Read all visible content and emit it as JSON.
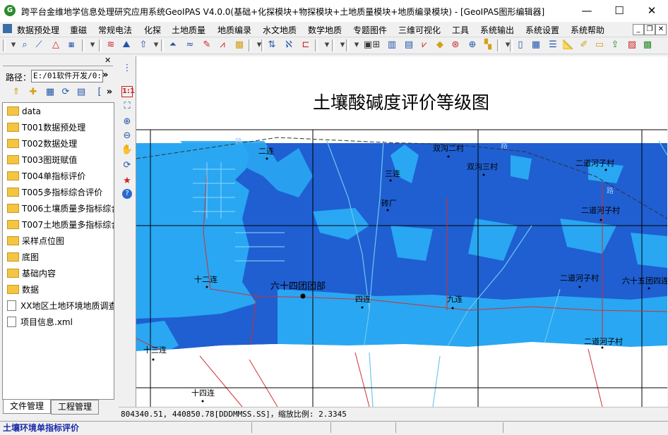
{
  "window": {
    "title": "跨平台金维地学信息处理研究应用系统GeoIPAS V4.0.0(基础+化探模块+物探模块+土地质量模块+地质编录模块) - [GeoIPAS图形编辑器]",
    "app_icon": "G",
    "minimize": "—",
    "maximize": "☐",
    "close": "✕"
  },
  "menu": {
    "items": [
      "数据预处理",
      "重磁",
      "常规电法",
      "化探",
      "土地质量",
      "地质编录",
      "水文地质",
      "数学地质",
      "专题图件",
      "三维可视化",
      "工具",
      "系统输出",
      "系统设置",
      "系统帮助"
    ],
    "mdi_min": "_",
    "mdi_restore": "❐",
    "mdi_close": "✕"
  },
  "left_panel": {
    "close_glyph": "✕",
    "path_label": "路径：",
    "path_value": "E:/01软件开发/0:",
    "path_more": "»",
    "tree_items": [
      {
        "label": "data",
        "type": "folder"
      },
      {
        "label": "T001数据预处理",
        "type": "folder"
      },
      {
        "label": "T002数据处理",
        "type": "folder"
      },
      {
        "label": "T003图斑赋值",
        "type": "folder"
      },
      {
        "label": "T004单指标评价",
        "type": "folder"
      },
      {
        "label": "T005多指标综合评价",
        "type": "folder"
      },
      {
        "label": "T006土壤质量多指标综合",
        "type": "folder"
      },
      {
        "label": "T007土地质量多指标综合",
        "type": "folder"
      },
      {
        "label": "采样点位图",
        "type": "folder"
      },
      {
        "label": "底图",
        "type": "folder"
      },
      {
        "label": "基础内容",
        "type": "folder"
      },
      {
        "label": "数据",
        "type": "folder"
      },
      {
        "label": "XX地区土地环境地质调查",
        "type": "file"
      },
      {
        "label": "项目信息.xml",
        "type": "file"
      }
    ],
    "tabs": [
      "文件管理",
      "工程管理"
    ]
  },
  "map": {
    "title": "土壤酸碱度评价等级图",
    "place_labels": [
      "二连",
      "双沟二村",
      "双沟三村",
      "三连",
      "二道河子村",
      "砖厂",
      "二道河子村",
      "十二连",
      "六十四团团部",
      "四连",
      "九连",
      "二道河子村",
      "六十五团四连",
      "十三连",
      "二道河子村",
      "十四连"
    ],
    "road_labels": [
      "铁",
      "路",
      "路"
    ],
    "colors": {
      "dark": "#1f5fd1",
      "light": "#29a7f2",
      "boundary": "#d03030",
      "grid": "#000000",
      "river": "#6cc8f0"
    }
  },
  "status": {
    "coordinates": "804340.51, 440850.78[DDDMMSS.SS]，缩放比例: 2.3345",
    "message": "土壤环境单指标评价"
  }
}
